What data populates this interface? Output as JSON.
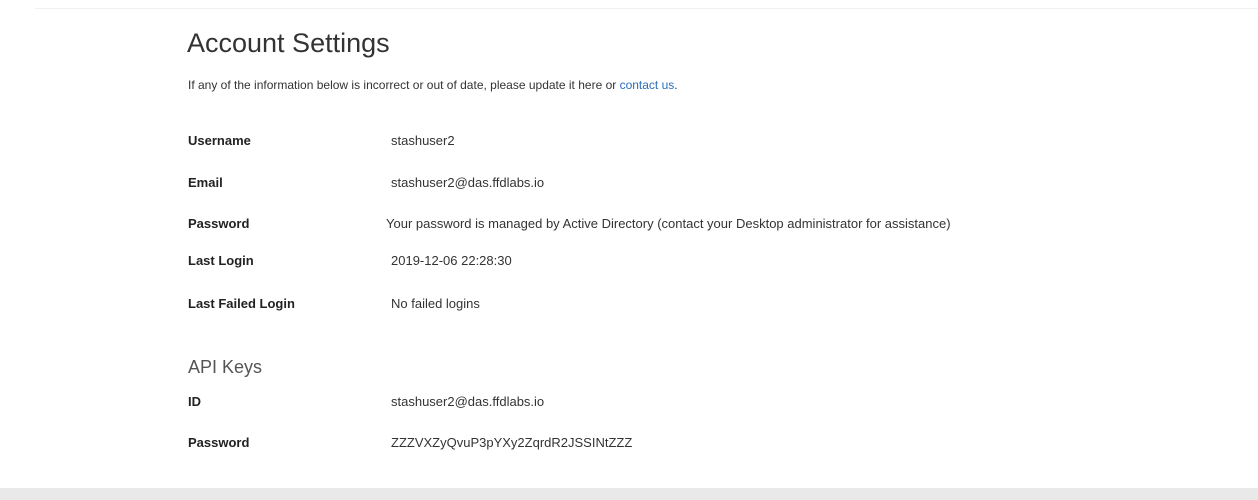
{
  "page": {
    "title": "Account Settings",
    "intro_text": "If any of the information below is incorrect or out of date, please update it here or ",
    "intro_link": "contact us",
    "intro_end": "."
  },
  "account": {
    "username_label": "Username",
    "username_value": "stashuser2",
    "email_label": "Email",
    "email_value": "stashuser2@das.ffdlabs.io",
    "password_label": "Password",
    "password_value": "Your password is managed by Active Directory (contact your Desktop administrator for assistance)",
    "last_login_label": "Last Login",
    "last_login_value": "2019-12-06 22:28:30",
    "last_failed_label": "Last Failed Login",
    "last_failed_value": "No failed logins"
  },
  "api_keys": {
    "title": "API Keys",
    "id_label": "ID",
    "id_value": "stashuser2@das.ffdlabs.io",
    "password_label": "Password",
    "password_value": "ZZZVXZyQvuP3pYXy2ZqrdR2JSSINtZZZ"
  }
}
